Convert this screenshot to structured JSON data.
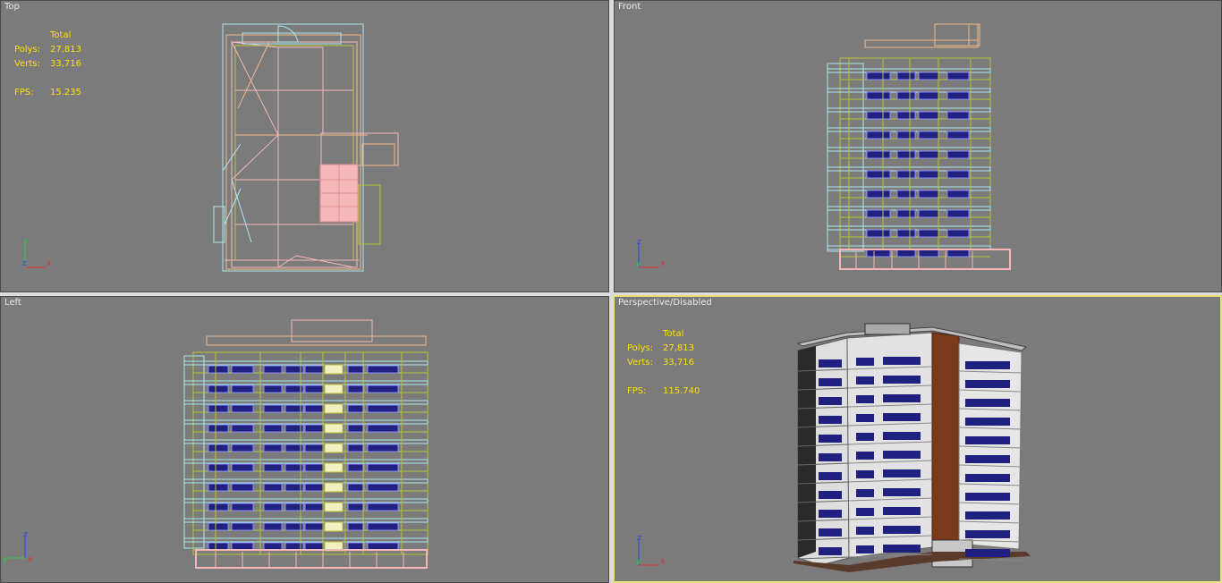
{
  "viewports": {
    "top": {
      "label": "Top"
    },
    "front": {
      "label": "Front"
    },
    "left": {
      "label": "Left"
    },
    "persp": {
      "label": "Perspective/Disabled"
    }
  },
  "stats_top": {
    "total_label": "Total",
    "polys_label": "Polys:",
    "polys": "27,813",
    "verts_label": "Verts:",
    "verts": "33,716",
    "fps_label": "FPS:",
    "fps": "15.235"
  },
  "stats_persp": {
    "total_label": "Total",
    "polys_label": "Polys:",
    "polys": "27,813",
    "verts_label": "Verts:",
    "verts": "33,716",
    "fps_label": "FPS:",
    "fps": "115.740"
  },
  "axes": {
    "x": "x",
    "y": "y",
    "z": "z"
  },
  "colors": {
    "viewport_bg": "#7b7b7b",
    "active_border": "#e8e07a",
    "stats_text": "#ffe000",
    "wire_pink": "#f4b8b8",
    "wire_orange": "#f0b88a",
    "wire_cyan": "#aee8f0",
    "wire_olive": "#b8c43a",
    "window_blue": "#202080"
  }
}
